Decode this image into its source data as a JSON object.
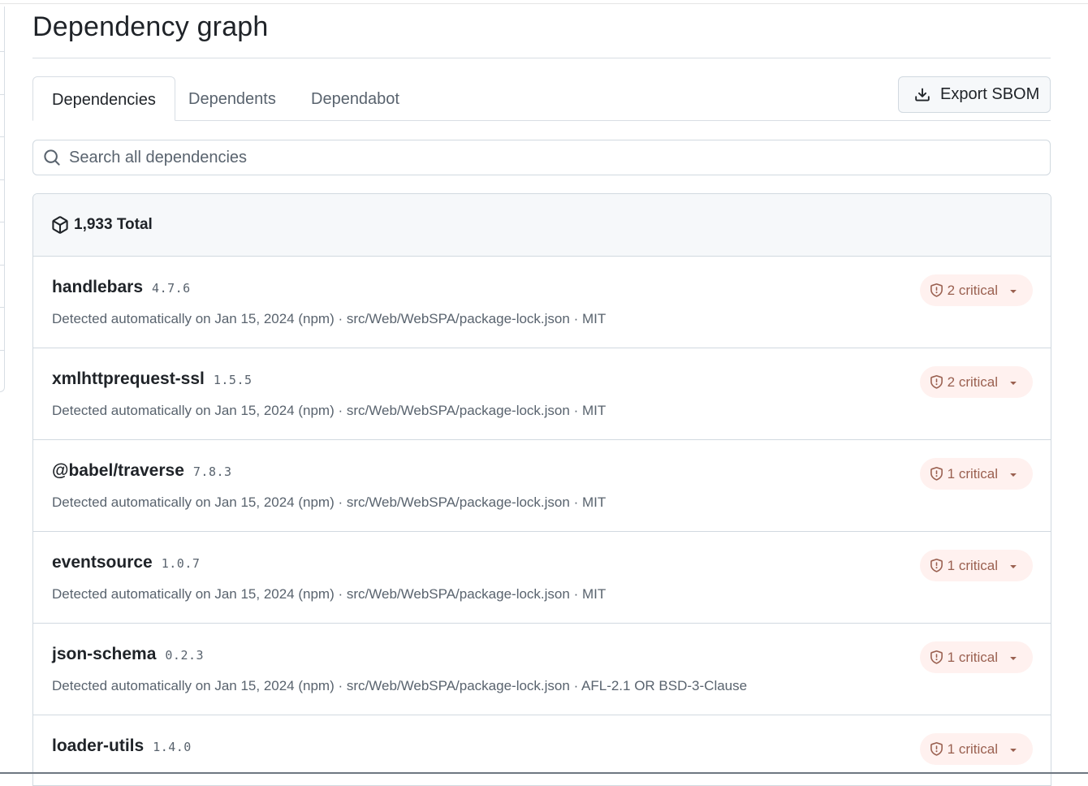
{
  "page": {
    "title": "Dependency graph"
  },
  "tabs": [
    {
      "label": "Dependencies",
      "selected": true
    },
    {
      "label": "Dependents",
      "selected": false
    },
    {
      "label": "Dependabot",
      "selected": false
    }
  ],
  "export_button": {
    "label": "Export SBOM",
    "icon": "download-icon"
  },
  "search": {
    "placeholder": "Search all dependencies",
    "value": "",
    "icon": "search-icon"
  },
  "summary": {
    "total_label": "1,933 Total",
    "icon": "package-icon"
  },
  "colors": {
    "critical_badge_bg": "#fff1ef",
    "critical_text": "#9a6050",
    "muted_text": "#59636e",
    "border": "#d1d9e0"
  },
  "dependencies": [
    {
      "name": "handlebars",
      "version": "4.7.6",
      "detected": "Detected automatically on Jan 15, 2024 (npm)",
      "sep1": " · ",
      "path": "src/Web/WebSPA/package-lock.json",
      "sep2": " · ",
      "license": "MIT",
      "alerts": "2 critical"
    },
    {
      "name": "xmlhttprequest-ssl",
      "version": "1.5.5",
      "detected": "Detected automatically on Jan 15, 2024 (npm)",
      "sep1": " · ",
      "path": "src/Web/WebSPA/package-lock.json",
      "sep2": " · ",
      "license": "MIT",
      "alerts": "2 critical"
    },
    {
      "name": "@babel/traverse",
      "version": "7.8.3",
      "detected": "Detected automatically on Jan 15, 2024 (npm)",
      "sep1": " · ",
      "path": "src/Web/WebSPA/package-lock.json",
      "sep2": " · ",
      "license": "MIT",
      "alerts": "1 critical"
    },
    {
      "name": "eventsource",
      "version": "1.0.7",
      "detected": "Detected automatically on Jan 15, 2024 (npm)",
      "sep1": " · ",
      "path": "src/Web/WebSPA/package-lock.json",
      "sep2": " · ",
      "license": "MIT",
      "alerts": "1 critical"
    },
    {
      "name": "json-schema",
      "version": "0.2.3",
      "detected": "Detected automatically on Jan 15, 2024 (npm)",
      "sep1": " · ",
      "path": "src/Web/WebSPA/package-lock.json",
      "sep2": " · ",
      "license": "AFL-2.1 OR BSD-3-Clause",
      "alerts": "1 critical"
    },
    {
      "name": "loader-utils",
      "version": "1.4.0",
      "detected": "",
      "sep1": "",
      "path": "",
      "sep2": "",
      "license": "",
      "alerts": "1 critical"
    }
  ]
}
